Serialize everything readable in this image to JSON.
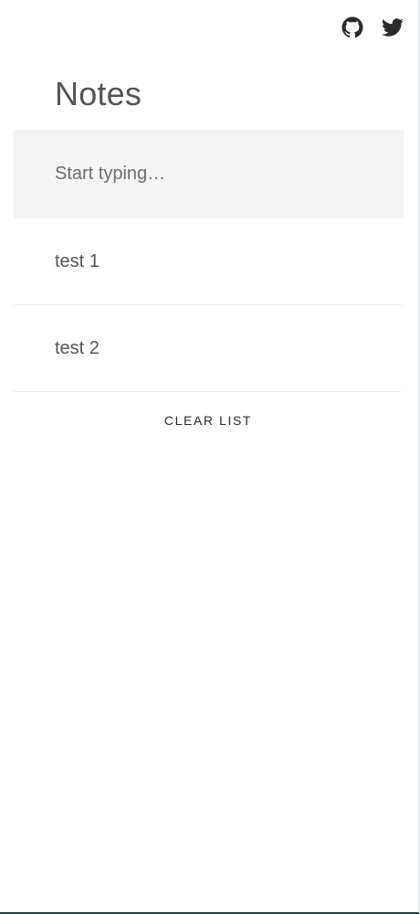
{
  "header": {
    "icons": [
      "github-icon",
      "twitter-icon"
    ]
  },
  "page": {
    "title": "Notes"
  },
  "input": {
    "placeholder": "Start typing…",
    "value": ""
  },
  "notes": [
    {
      "text": "test 1"
    },
    {
      "text": "test 2"
    }
  ],
  "actions": {
    "clear_label": "CLEAR LIST"
  }
}
